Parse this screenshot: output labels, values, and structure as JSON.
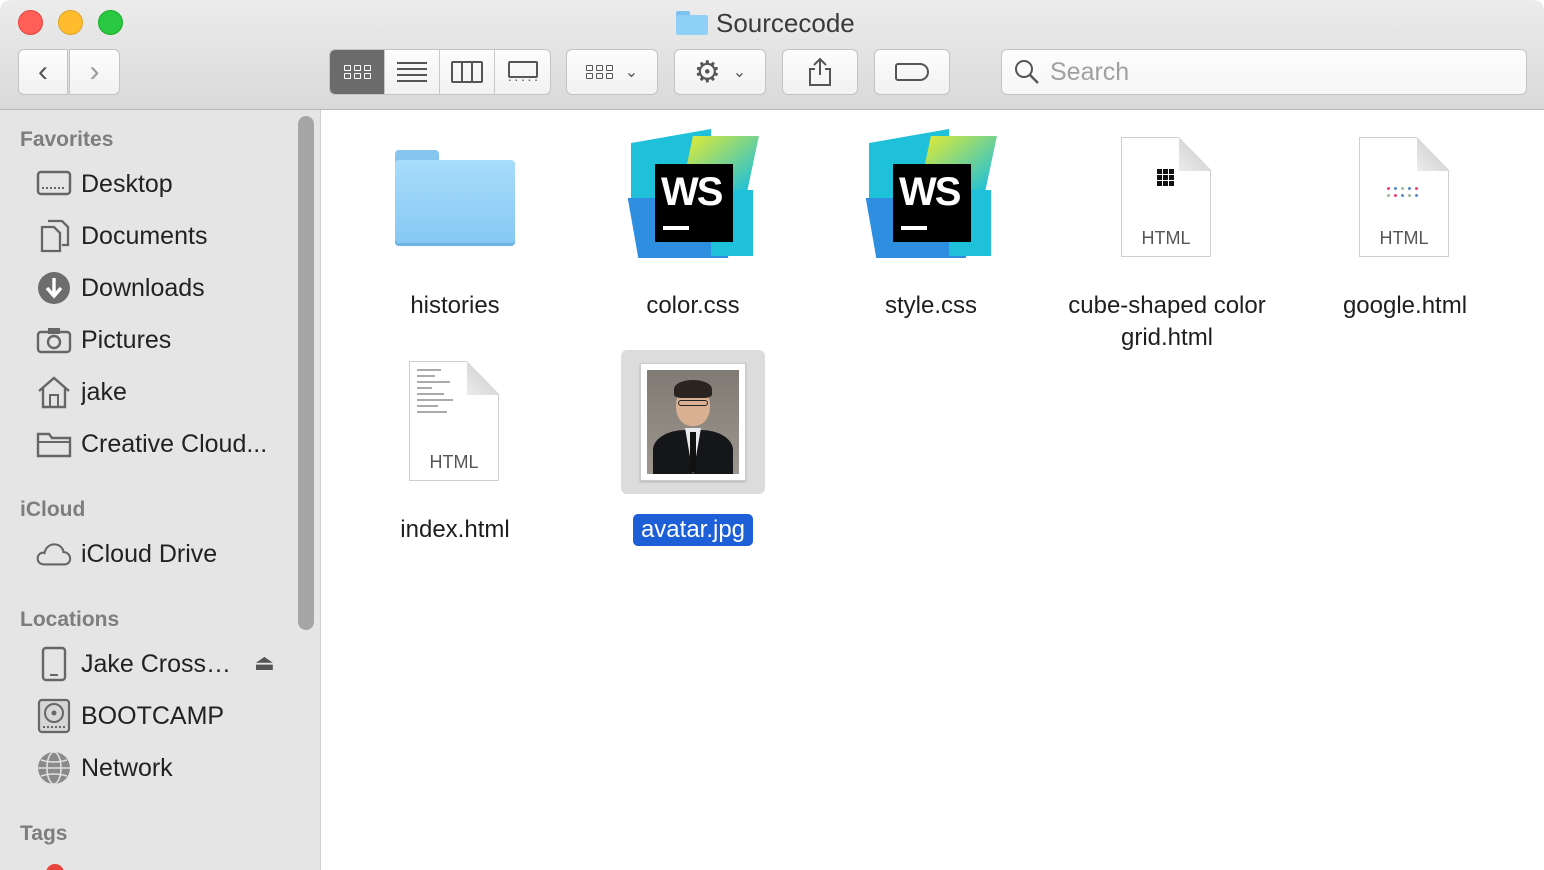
{
  "window": {
    "title": "Sourcecode"
  },
  "toolbar": {
    "back_glyph": "‹",
    "forward_glyph": "›",
    "gear_glyph": "⚙",
    "chevron_glyph": "⌄",
    "share_glyph": "⇪",
    "view_modes": [
      "icon-view",
      "list-view",
      "column-view",
      "gallery-view"
    ],
    "active_view": "icon-view"
  },
  "search": {
    "placeholder": "Search",
    "value": ""
  },
  "sidebar": {
    "sections": [
      {
        "title": "Favorites",
        "items": [
          {
            "label": "Desktop",
            "icon": "desktop-icon"
          },
          {
            "label": "Documents",
            "icon": "documents-icon"
          },
          {
            "label": "Downloads",
            "icon": "downloads-icon"
          },
          {
            "label": "Pictures",
            "icon": "pictures-icon"
          },
          {
            "label": "jake",
            "icon": "home-icon"
          },
          {
            "label": "Creative Cloud...",
            "icon": "folder-icon"
          }
        ]
      },
      {
        "title": "iCloud",
        "items": [
          {
            "label": "iCloud Drive",
            "icon": "cloud-icon"
          }
        ]
      },
      {
        "title": "Locations",
        "items": [
          {
            "label": "Jake Cross…",
            "icon": "device-icon",
            "eject": "⏏"
          },
          {
            "label": "BOOTCAMP",
            "icon": "disk-icon"
          },
          {
            "label": "Network",
            "icon": "network-icon"
          }
        ]
      },
      {
        "title": "Tags",
        "items": []
      }
    ]
  },
  "files": [
    {
      "name": "histories",
      "kind": "folder"
    },
    {
      "name": "color.css",
      "kind": "webstorm"
    },
    {
      "name": "style.css",
      "kind": "webstorm"
    },
    {
      "name": "cube-shaped color grid.html",
      "kind": "html",
      "ext": "HTML"
    },
    {
      "name": "google.html",
      "kind": "html",
      "ext": "HTML"
    },
    {
      "name": "index.html",
      "kind": "html",
      "ext": "HTML"
    },
    {
      "name": "avatar.jpg",
      "kind": "image",
      "selected": true
    }
  ],
  "ws_logo_text": "WS",
  "colors": {
    "selection": "#1d5fd6",
    "folder": "#8fd0f6",
    "sidebar_bg": "#e5e5e5"
  }
}
